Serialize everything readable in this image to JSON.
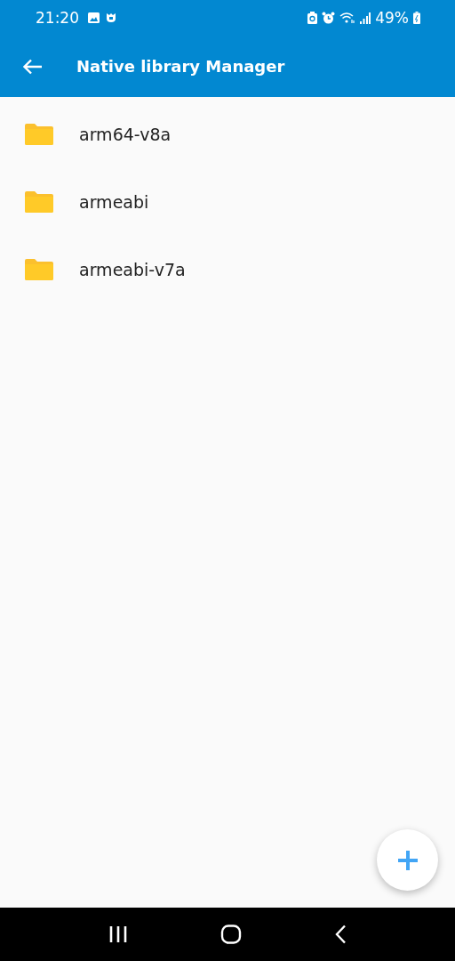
{
  "status_bar": {
    "time": "21:20",
    "battery": "49%"
  },
  "app_bar": {
    "title": "Native library Manager"
  },
  "folders": [
    {
      "name": "arm64-v8a"
    },
    {
      "name": "armeabi"
    },
    {
      "name": "armeabi-v7a"
    }
  ]
}
